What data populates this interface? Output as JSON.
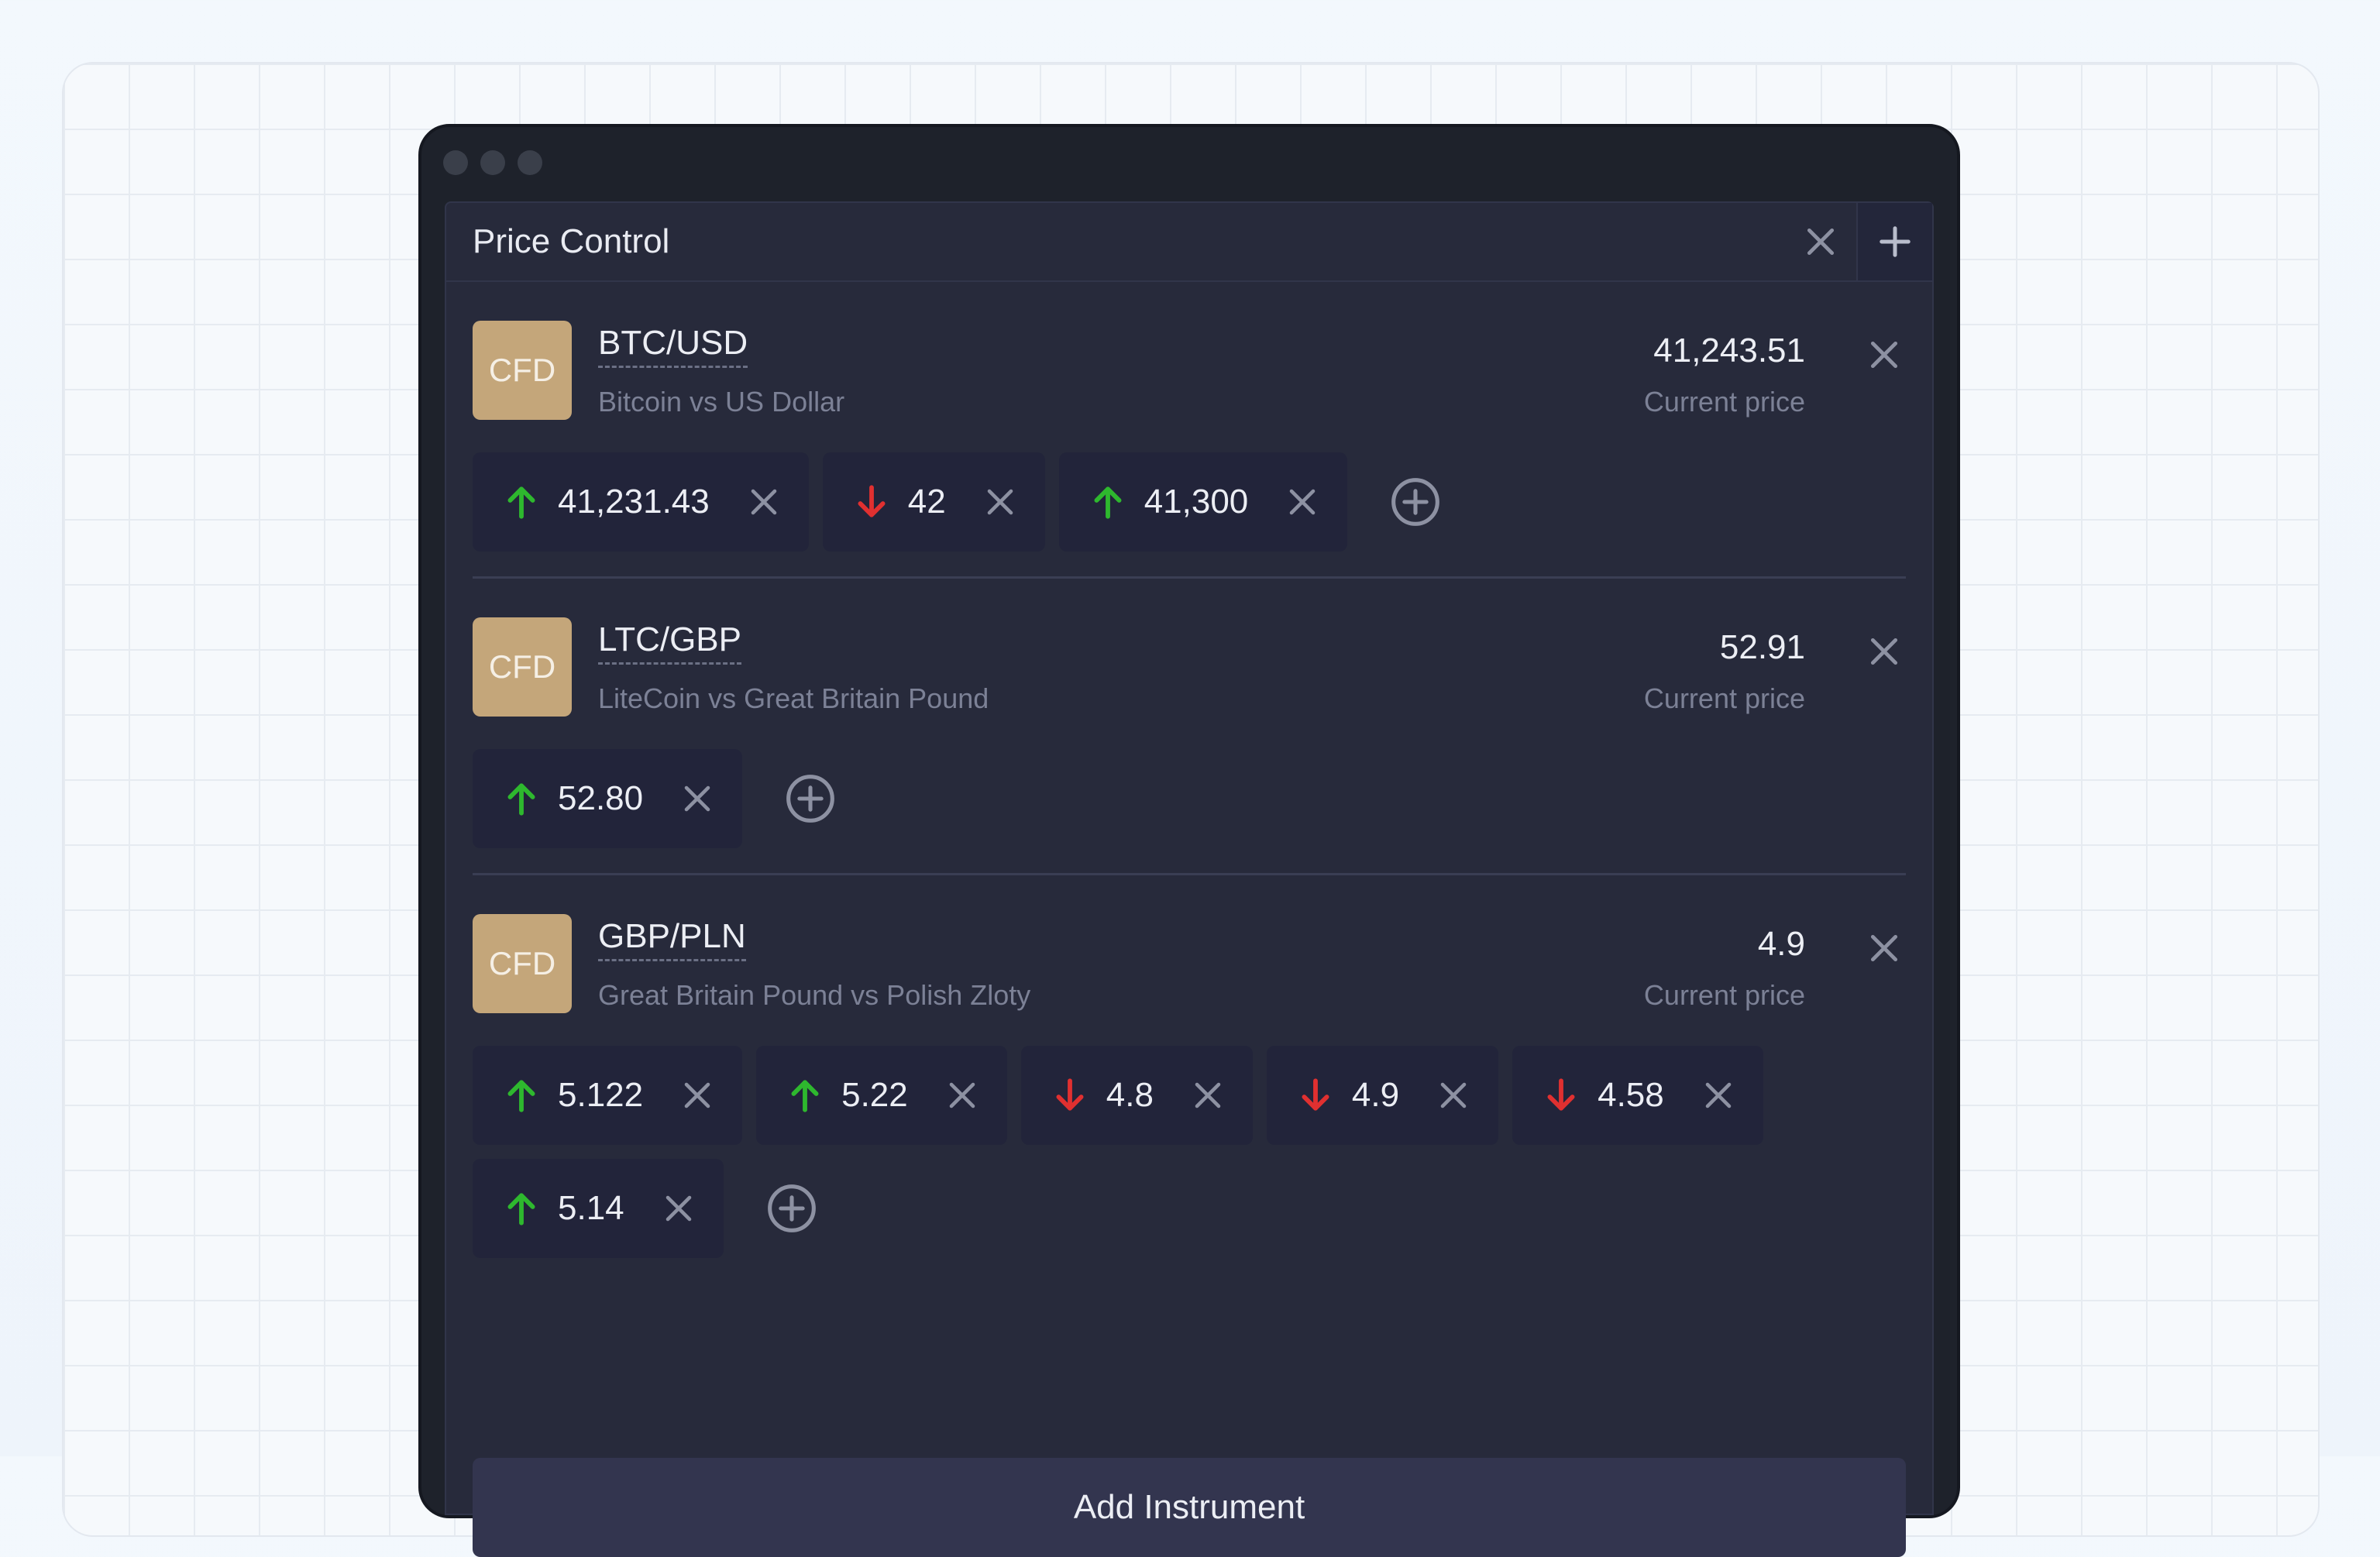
{
  "window": {
    "title": "Price Control"
  },
  "instruments": [
    {
      "badge": "CFD",
      "symbol": "BTC/USD",
      "description": "Bitcoin vs US Dollar",
      "price": "41,243.51",
      "price_label": "Current price",
      "levels": [
        {
          "direction": "up",
          "value": "41,231.43"
        },
        {
          "direction": "down",
          "value": "42"
        },
        {
          "direction": "up",
          "value": "41,300"
        }
      ]
    },
    {
      "badge": "CFD",
      "symbol": "LTC/GBP",
      "description": "LiteCoin vs Great Britain Pound",
      "price": "52.91",
      "price_label": "Current price",
      "levels": [
        {
          "direction": "up",
          "value": "52.80"
        }
      ]
    },
    {
      "badge": "CFD",
      "symbol": "GBP/PLN",
      "description": "Great Britain Pound vs Polish Zloty",
      "price": "4.9",
      "price_label": "Current price",
      "levels": [
        {
          "direction": "up",
          "value": "5.122"
        },
        {
          "direction": "up",
          "value": "5.22"
        },
        {
          "direction": "down",
          "value": "4.8"
        },
        {
          "direction": "down",
          "value": "4.9"
        },
        {
          "direction": "down",
          "value": "4.58"
        },
        {
          "direction": "up",
          "value": "5.14"
        }
      ]
    }
  ],
  "add_instrument_label": "Add Instrument",
  "colors": {
    "up": "#2eb82e",
    "down": "#e03030",
    "badge": "#c4a67a",
    "panel": "#272a3b"
  }
}
